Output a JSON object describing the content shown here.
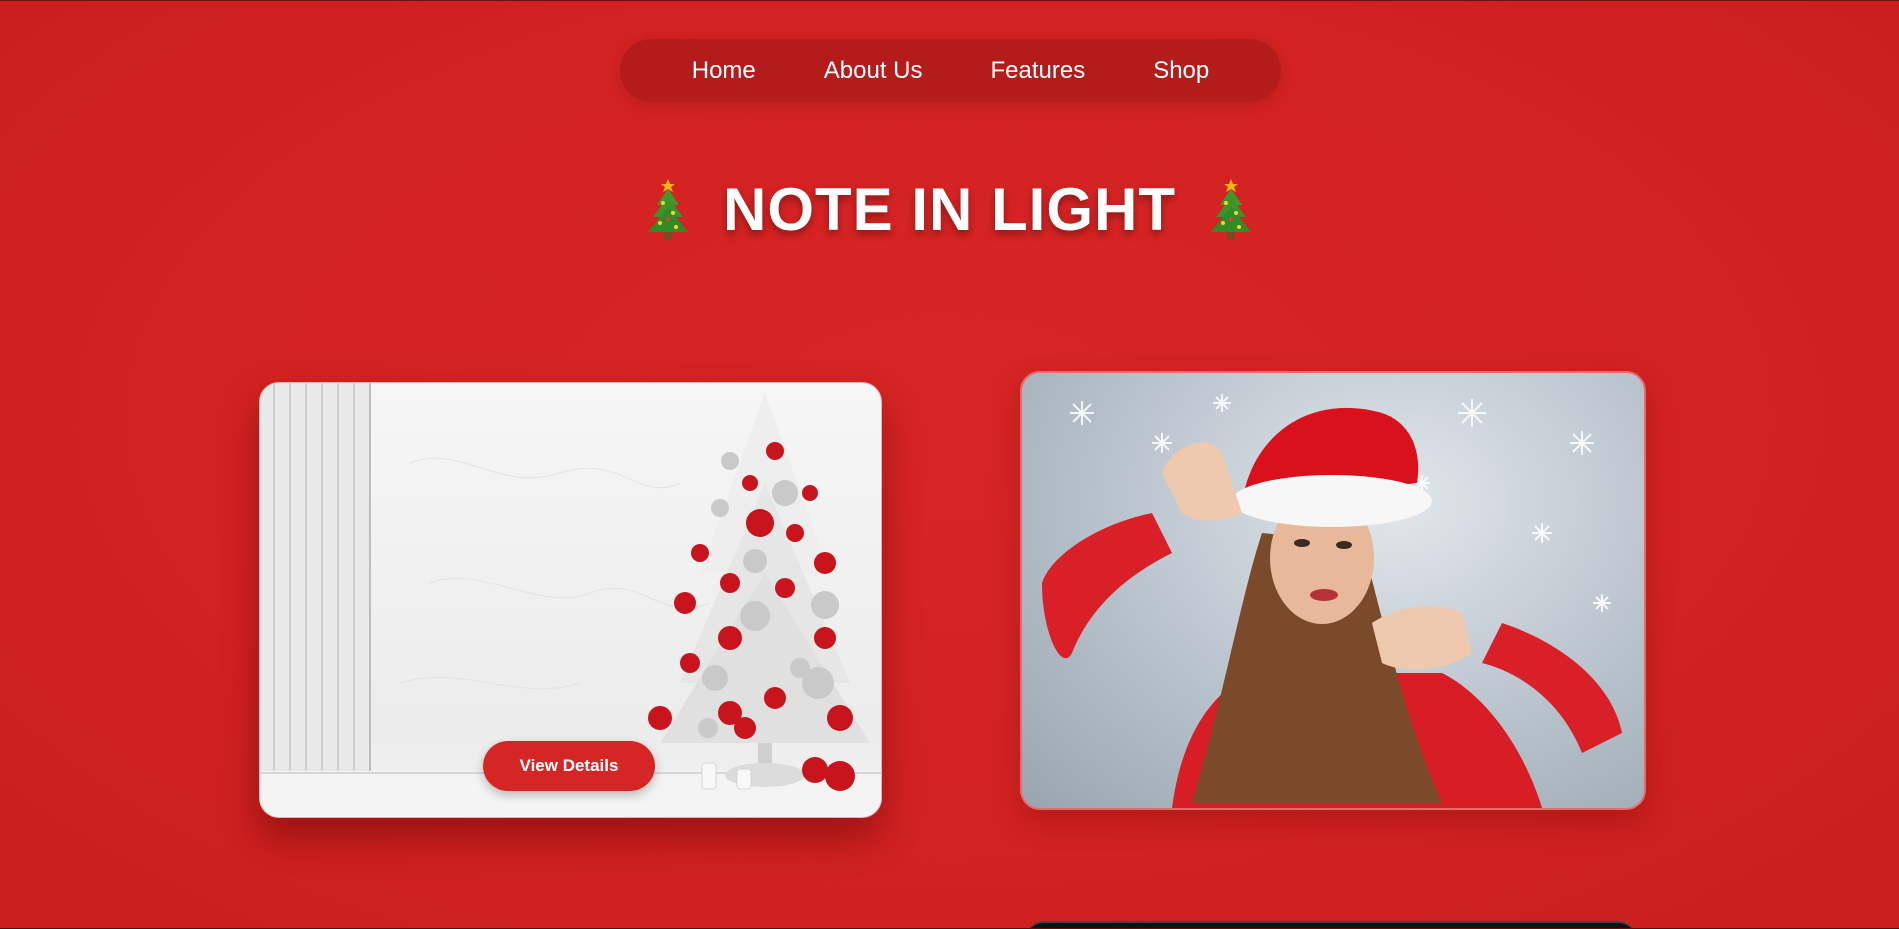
{
  "nav": {
    "items": [
      "Home",
      "About Us",
      "Features",
      "Shop"
    ]
  },
  "hero": {
    "title": "NOTE IN LIGHT",
    "left_icon": "christmas-tree-icon",
    "right_icon": "christmas-tree-icon"
  },
  "cards": {
    "left": {
      "image": "white christmas tree with red and silver ornaments",
      "button_label": "View Details"
    },
    "right": {
      "image": "woman in santa hat making frame gesture with snowflakes"
    }
  },
  "colors": {
    "background": "#d52424",
    "nav_bg": "#b41c1c",
    "button_bg": "#d52626",
    "text": "#ffffff"
  }
}
